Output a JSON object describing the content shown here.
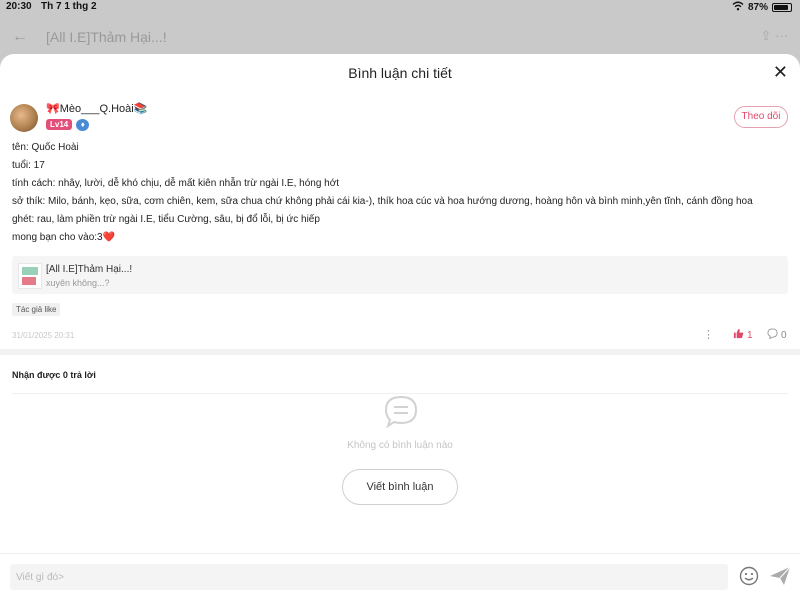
{
  "status_bar": {
    "time": "20:30",
    "date": "Th 7 1 thg 2",
    "battery": "87%"
  },
  "background_header": {
    "title": "[All I.E]Thảm Hại...!"
  },
  "modal": {
    "title": "Bình luận chi tiết"
  },
  "author": {
    "name": "Mèo___Q.Hoài",
    "level": "Lv14",
    "follow_label": "Theo dõi"
  },
  "comment": {
    "lines": [
      "tên: Quốc Hoài",
      "tuổi: 17",
      "tính cách: nhây, lười, dễ khó chịu, dễ mất kiên nhẫn trừ ngài I.E, hóng hớt",
      "sở thík: Milo, bánh, kẹo, sữa, cơm chiên, kem, sữa chua chứ không phải cái kia-), thík hoa cúc và hoa hướng dương, hoàng hôn và bình minh,yên tĩnh, cánh đồng hoa",
      "ghét: rau, làm phiền trừ ngài I.E, tiểu Cường, sâu, bị đổ lỗi, bị ức hiếp",
      "mong bạn cho vào:3"
    ],
    "heart_emoji": "❤️"
  },
  "linked_story": {
    "title": "[All I.E]Thảm Hại...!",
    "subtitle": "xuyên không...?"
  },
  "author_like_tag": "Tác giả like",
  "timestamp": "31/01/2025 20:31",
  "likes": "1",
  "replies_count": "0",
  "replies_section": {
    "title": "Nhận được 0 trả lời",
    "empty_text": "Không có bình luận nào",
    "write_button": "Viết bình luận"
  },
  "input": {
    "placeholder": "Viết gì đó>"
  },
  "colors": {
    "accent": "#e04a6a",
    "lv_badge": "#e44f7a"
  }
}
